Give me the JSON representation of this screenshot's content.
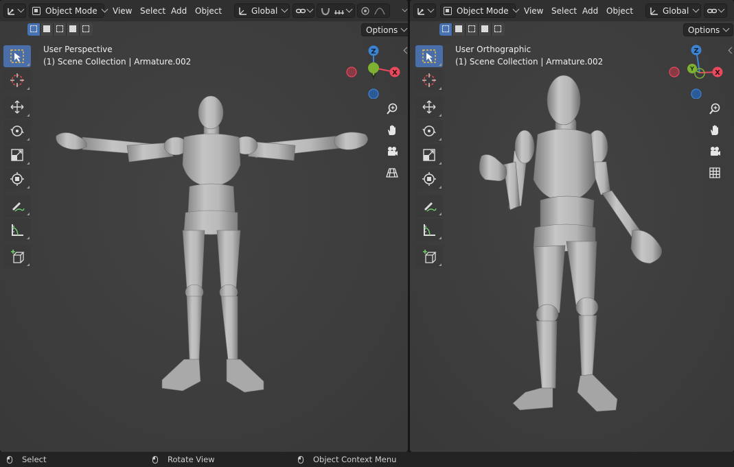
{
  "toolbar_common": {
    "mode": "Object Mode",
    "menus": [
      "View",
      "Select",
      "Add",
      "Object"
    ],
    "orientation": "Global",
    "options_label": "Options"
  },
  "left_viewport": {
    "view_name": "User Perspective",
    "collection_info": "(1) Scene Collection | Armature.002"
  },
  "right_viewport": {
    "view_name": "User Orthographic",
    "collection_info": "(1) Scene Collection | Armature.002"
  },
  "gizmo": {
    "x": "X",
    "y": "Y",
    "z": "Z"
  },
  "statusbar": {
    "select": "Select",
    "rotate_view": "Rotate View",
    "context_menu": "Object Context Menu"
  },
  "colors": {
    "accent": "#4772b3",
    "axis_x": "#e8495d",
    "axis_y": "#7eb032",
    "axis_z": "#3d83d4"
  }
}
